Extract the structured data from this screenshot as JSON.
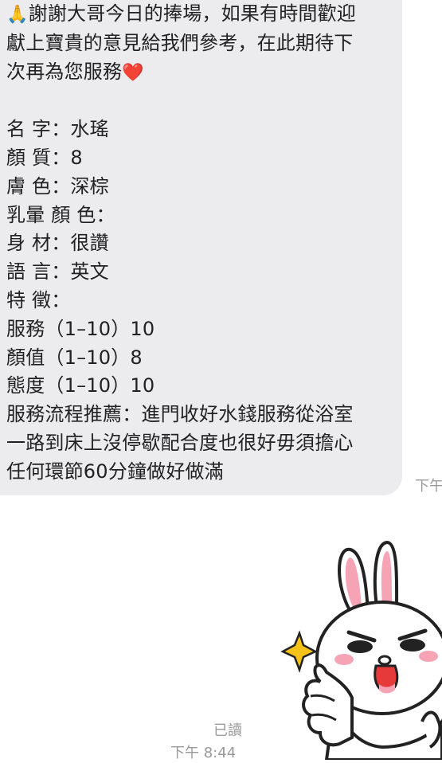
{
  "message": {
    "greeting_emoji": "🙏",
    "greeting_lines": [
      "謝謝大哥今日的捧場，如果有時間歡迎",
      "獻上寶貴的意見給我們參考，在此期待下",
      "次再為您服務"
    ],
    "heart_emoji": "❤️",
    "details": [
      "名 字：水瑤",
      "顏 質：8",
      "膚 色：深棕",
      "乳暈 顏 色：",
      "身 材：很讚",
      "語 言：英文",
      "特 徵：",
      "服務（1–10）10",
      "顏值（1–10）8",
      "態度（1–10）10",
      "服務流程推薦：進門收好水錢服務從浴室",
      "一路到床上沒停歇配合度也很好毋須擔心",
      "任何環節60分鐘做好做滿"
    ],
    "time_partial": "下午"
  },
  "status": {
    "read_label": "已讀",
    "time": "下午 8:44"
  },
  "sticker": {
    "icon": "rabbit-thumbs-up-sticker"
  }
}
